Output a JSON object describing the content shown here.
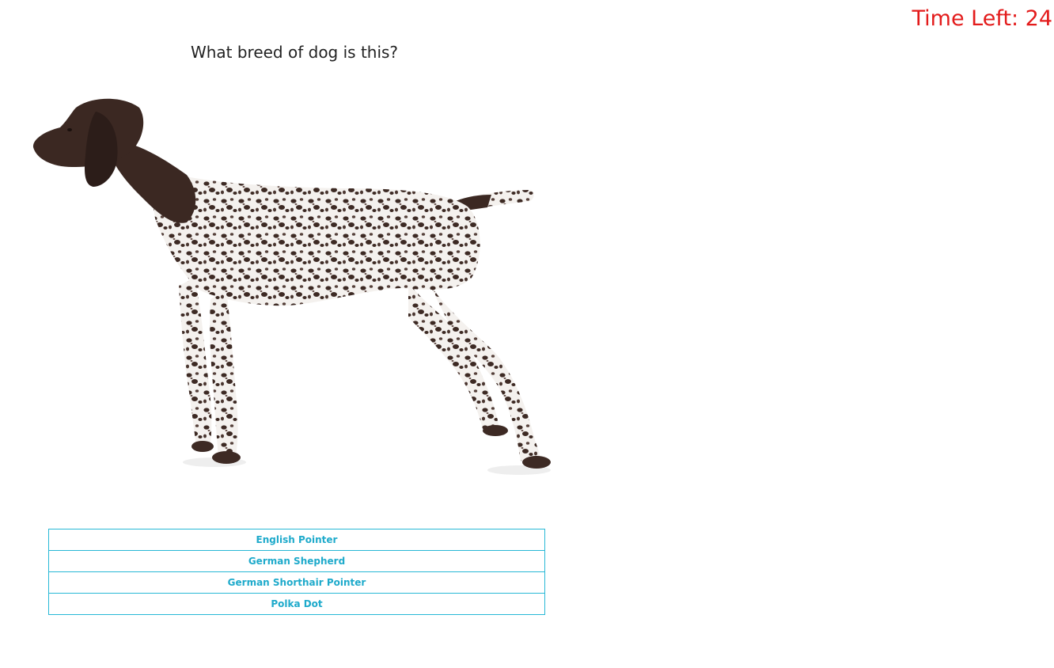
{
  "timer": {
    "label": "Time Left: 24",
    "color": "#e31b1b"
  },
  "question": {
    "text": "What breed of dog is this?"
  },
  "image": {
    "subject": "dog-photo"
  },
  "options": [
    {
      "label": "English Pointer"
    },
    {
      "label": "German Shepherd"
    },
    {
      "label": "German Shorthair Pointer"
    },
    {
      "label": "Polka Dot"
    }
  ],
  "colors": {
    "option_border": "#27b8d6",
    "option_text": "#1eaacb"
  }
}
